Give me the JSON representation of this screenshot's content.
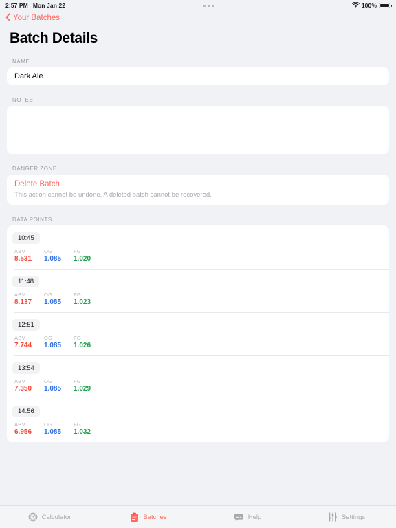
{
  "statusbar": {
    "time": "2:57 PM",
    "date": "Mon Jan 22",
    "center_indicator": "multitasking-dots",
    "wifi": "wifi-icon",
    "battery_percent": "100%"
  },
  "nav": {
    "back_label": "Your Batches",
    "back_icon": "chevron-left-icon",
    "accent_color": "#ff6961"
  },
  "page": {
    "title": "Batch Details"
  },
  "name_section": {
    "label": "NAME",
    "value": "Dark Ale",
    "placeholder": "Name"
  },
  "notes_section": {
    "label": "NOTES",
    "value": "",
    "placeholder": ""
  },
  "danger_section": {
    "label": "DANGER ZONE",
    "action_label": "Delete Batch",
    "description": "This action cannot be undone. A deleted batch cannot be recovered.",
    "action_color": "#ff6961"
  },
  "data_points_section": {
    "label": "DATA POINTS",
    "metric_labels": {
      "abv": "ABV",
      "og": "OG",
      "fg": "FG"
    },
    "colors": {
      "abv": "#f2483c",
      "og": "#2f6fe4",
      "fg": "#1f9e4b"
    },
    "rows": [
      {
        "time": "10:45",
        "abv": "8.531",
        "og": "1.085",
        "fg": "1.020"
      },
      {
        "time": "11:48",
        "abv": "8.137",
        "og": "1.085",
        "fg": "1.023"
      },
      {
        "time": "12:51",
        "abv": "7.744",
        "og": "1.085",
        "fg": "1.026"
      },
      {
        "time": "13:54",
        "abv": "7.350",
        "og": "1.085",
        "fg": "1.029"
      },
      {
        "time": "14:56",
        "abv": "6.956",
        "og": "1.085",
        "fg": "1.032"
      }
    ]
  },
  "tabbar": {
    "items": [
      {
        "label": "Calculator",
        "icon": "gauge-icon",
        "active": false
      },
      {
        "label": "Batches",
        "icon": "clipboard-icon",
        "active": true
      },
      {
        "label": "Help",
        "icon": "chat-bubble-icon",
        "active": false
      },
      {
        "label": "Settings",
        "icon": "sliders-icon",
        "active": false
      }
    ]
  }
}
